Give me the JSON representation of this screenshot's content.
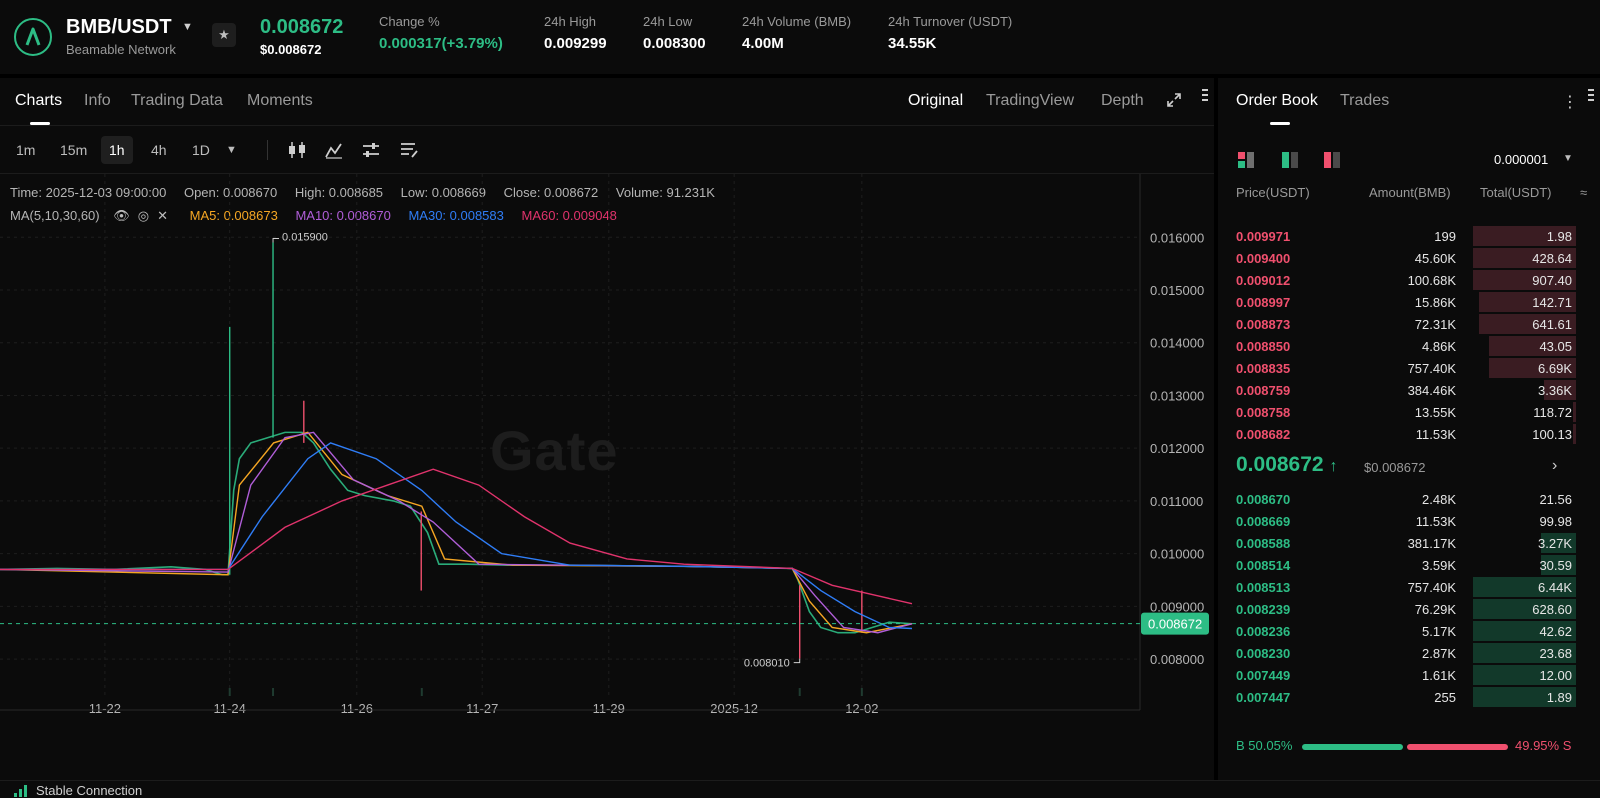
{
  "header": {
    "pair": "BMB/USDT",
    "project": "Beamable Network",
    "last_price": "0.008672",
    "last_price_usd": "$0.008672",
    "stats": [
      {
        "label": "Change %",
        "value": "0.000317(+3.79%)",
        "color": "green"
      },
      {
        "label": "24h High",
        "value": "0.009299"
      },
      {
        "label": "24h Low",
        "value": "0.008300"
      },
      {
        "label": "24h Volume (BMB)",
        "value": "4.00M"
      },
      {
        "label": "24h Turnover (USDT)",
        "value": "34.55K"
      }
    ]
  },
  "chart_tabs": [
    "Charts",
    "Info",
    "Trading Data",
    "Moments"
  ],
  "view_modes": [
    "Original",
    "TradingView",
    "Depth"
  ],
  "intervals": [
    "1m",
    "15m",
    "1h",
    "4h",
    "1D"
  ],
  "active_interval": "1h",
  "candle_info": {
    "time": "Time: 2025-12-03 09:00:00",
    "open": "Open: 0.008670",
    "high": "High: 0.008685",
    "low": "Low: 0.008669",
    "close": "Close: 0.008672",
    "volume": "Volume: 91.231K"
  },
  "ma_info": {
    "label": "MA(5,10,30,60)",
    "ma5": "MA5: 0.008673",
    "ma10": "MA10: 0.008670",
    "ma30": "MA30: 0.008583",
    "ma60": "MA60: 0.009048"
  },
  "watermark": "Gate",
  "colors": {
    "up": "#2dbd85",
    "down": "#f0506e",
    "ma5": "#f5a623",
    "ma10": "#b05ed8",
    "ma30": "#2f7df6",
    "ma60": "#e0336c"
  },
  "chart_data": {
    "type": "line",
    "title": "",
    "x_ticks": [
      "11-22",
      "11-24",
      "11-26",
      "11-27",
      "11-29",
      "2025-12",
      "12-02"
    ],
    "y_ticks": [
      "0.016000",
      "0.015000",
      "0.014000",
      "0.013000",
      "0.012000",
      "0.011000",
      "0.010000",
      "0.009000",
      "0.008000"
    ],
    "ylim": [
      0.0073,
      0.0172
    ],
    "current_price_label": "0.008672",
    "current_price": 0.008672,
    "high_marker": {
      "label": "0.015900",
      "value": 0.0159,
      "x": 0.2395
    },
    "low_marker": {
      "label": "0.008010",
      "value": 0.00801,
      "x": 0.7015
    },
    "price_path": [
      [
        0.0,
        0.0097
      ],
      [
        0.05,
        0.00972
      ],
      [
        0.1,
        0.0097
      ],
      [
        0.15,
        0.00975
      ],
      [
        0.18,
        0.0097
      ],
      [
        0.195,
        0.0096
      ],
      [
        0.2,
        0.0096
      ],
      [
        0.205,
        0.0112
      ],
      [
        0.21,
        0.0118
      ],
      [
        0.22,
        0.0121
      ],
      [
        0.235,
        0.0122
      ],
      [
        0.25,
        0.0123
      ],
      [
        0.265,
        0.0123
      ],
      [
        0.275,
        0.0121
      ],
      [
        0.29,
        0.0116
      ],
      [
        0.305,
        0.0112
      ],
      [
        0.32,
        0.0111
      ],
      [
        0.345,
        0.011
      ],
      [
        0.36,
        0.0109
      ],
      [
        0.375,
        0.0104
      ],
      [
        0.385,
        0.0098
      ],
      [
        0.41,
        0.0098
      ],
      [
        0.45,
        0.00978
      ],
      [
        0.5,
        0.00978
      ],
      [
        0.55,
        0.00977
      ],
      [
        0.6,
        0.00976
      ],
      [
        0.65,
        0.00974
      ],
      [
        0.695,
        0.00972
      ],
      [
        0.7,
        0.0095
      ],
      [
        0.71,
        0.0089
      ],
      [
        0.72,
        0.0086
      ],
      [
        0.735,
        0.0085
      ],
      [
        0.75,
        0.0085
      ],
      [
        0.765,
        0.0086
      ],
      [
        0.78,
        0.0087
      ],
      [
        0.8,
        0.00867
      ]
    ],
    "wicks": [
      {
        "x": 0.2015,
        "hi": 0.0143,
        "lo": 0.0096
      },
      {
        "x": 0.2395,
        "hi": 0.0159,
        "lo": 0.0122
      },
      {
        "x": 0.2665,
        "hi": 0.0129,
        "lo": 0.0121
      },
      {
        "x": 0.3695,
        "hi": 0.0108,
        "lo": 0.0093
      },
      {
        "x": 0.7015,
        "hi": 0.0094,
        "lo": 0.00801
      },
      {
        "x": 0.756,
        "hi": 0.0093,
        "lo": 0.0085
      }
    ],
    "series": [
      {
        "name": "MA5",
        "x": [
          0.0,
          0.2,
          0.21,
          0.24,
          0.27,
          0.3,
          0.34,
          0.37,
          0.39,
          0.45,
          0.6,
          0.695,
          0.71,
          0.73,
          0.76,
          0.8
        ],
        "y": [
          0.0097,
          0.0096,
          0.0113,
          0.0121,
          0.0123,
          0.0115,
          0.0111,
          0.0109,
          0.0099,
          0.00978,
          0.00976,
          0.00972,
          0.0091,
          0.0086,
          0.0085,
          0.00867
        ]
      },
      {
        "name": "MA10",
        "x": [
          0.0,
          0.2,
          0.22,
          0.25,
          0.275,
          0.31,
          0.35,
          0.38,
          0.42,
          0.5,
          0.6,
          0.695,
          0.715,
          0.74,
          0.77,
          0.8
        ],
        "y": [
          0.0097,
          0.00965,
          0.0113,
          0.0122,
          0.0123,
          0.0114,
          0.011,
          0.0106,
          0.0098,
          0.00978,
          0.00976,
          0.00972,
          0.0092,
          0.0086,
          0.0085,
          0.00867
        ]
      },
      {
        "name": "MA30",
        "x": [
          0.0,
          0.2,
          0.23,
          0.27,
          0.29,
          0.33,
          0.37,
          0.4,
          0.44,
          0.5,
          0.6,
          0.695,
          0.72,
          0.75,
          0.78,
          0.8
        ],
        "y": [
          0.0097,
          0.0097,
          0.0107,
          0.0118,
          0.0121,
          0.0118,
          0.0112,
          0.0106,
          0.01,
          0.00978,
          0.00976,
          0.00972,
          0.0093,
          0.0089,
          0.0086,
          0.00858
        ]
      },
      {
        "name": "MA60",
        "x": [
          0.0,
          0.2,
          0.25,
          0.3,
          0.34,
          0.38,
          0.42,
          0.46,
          0.5,
          0.55,
          0.6,
          0.695,
          0.73,
          0.77,
          0.8
        ],
        "y": [
          0.0097,
          0.0097,
          0.0105,
          0.011,
          0.0113,
          0.0116,
          0.0113,
          0.0107,
          0.0102,
          0.0099,
          0.0098,
          0.00972,
          0.0094,
          0.0092,
          0.00905
        ]
      }
    ],
    "volume_spikes_x": [
      0.2015,
      0.2395,
      0.37,
      0.7015,
      0.756
    ]
  },
  "orderbook": {
    "tabs": [
      "Order Book",
      "Trades"
    ],
    "precision": "0.000001",
    "headers": [
      "Price(USDT)",
      "Amount(BMB)",
      "Total(USDT)"
    ],
    "asks": [
      {
        "price": "0.009971",
        "amount": "199",
        "total": "1.98",
        "depth": 0.32
      },
      {
        "price": "0.009400",
        "amount": "45.60K",
        "total": "428.64",
        "depth": 0.32
      },
      {
        "price": "0.009012",
        "amount": "100.68K",
        "total": "907.40",
        "depth": 0.32
      },
      {
        "price": "0.008997",
        "amount": "15.86K",
        "total": "142.71",
        "depth": 0.3
      },
      {
        "price": "0.008873",
        "amount": "72.31K",
        "total": "641.61",
        "depth": 0.3
      },
      {
        "price": "0.008850",
        "amount": "4.86K",
        "total": "43.05",
        "depth": 0.27
      },
      {
        "price": "0.008835",
        "amount": "757.40K",
        "total": "6.69K",
        "depth": 0.27
      },
      {
        "price": "0.008759",
        "amount": "384.46K",
        "total": "3.36K",
        "depth": 0.1
      },
      {
        "price": "0.008758",
        "amount": "13.55K",
        "total": "118.72",
        "depth": 0.01
      },
      {
        "price": "0.008682",
        "amount": "11.53K",
        "total": "100.13",
        "depth": 0.01
      }
    ],
    "mid_price": "0.008672",
    "mid_arrow": "↑",
    "mid_usd": "$0.008672",
    "bids": [
      {
        "price": "0.008670",
        "amount": "2.48K",
        "total": "21.56",
        "depth": 0.0
      },
      {
        "price": "0.008669",
        "amount": "11.53K",
        "total": "99.98",
        "depth": 0.0
      },
      {
        "price": "0.008588",
        "amount": "381.17K",
        "total": "3.27K",
        "depth": 0.11
      },
      {
        "price": "0.008514",
        "amount": "3.59K",
        "total": "30.59",
        "depth": 0.11
      },
      {
        "price": "0.008513",
        "amount": "757.40K",
        "total": "6.44K",
        "depth": 0.32
      },
      {
        "price": "0.008239",
        "amount": "76.29K",
        "total": "628.60",
        "depth": 0.32
      },
      {
        "price": "0.008236",
        "amount": "5.17K",
        "total": "42.62",
        "depth": 0.32
      },
      {
        "price": "0.008230",
        "amount": "2.87K",
        "total": "23.68",
        "depth": 0.32
      },
      {
        "price": "0.007449",
        "amount": "1.61K",
        "total": "12.00",
        "depth": 0.32
      },
      {
        "price": "0.007447",
        "amount": "255",
        "total": "1.89",
        "depth": 0.32
      }
    ],
    "buy_ratio": "50.05%",
    "sell_ratio": "49.95%",
    "buy_label": "B",
    "sell_label": "S",
    "buy_fraction": 0.5005
  },
  "status": {
    "text": "Stable Connection"
  }
}
